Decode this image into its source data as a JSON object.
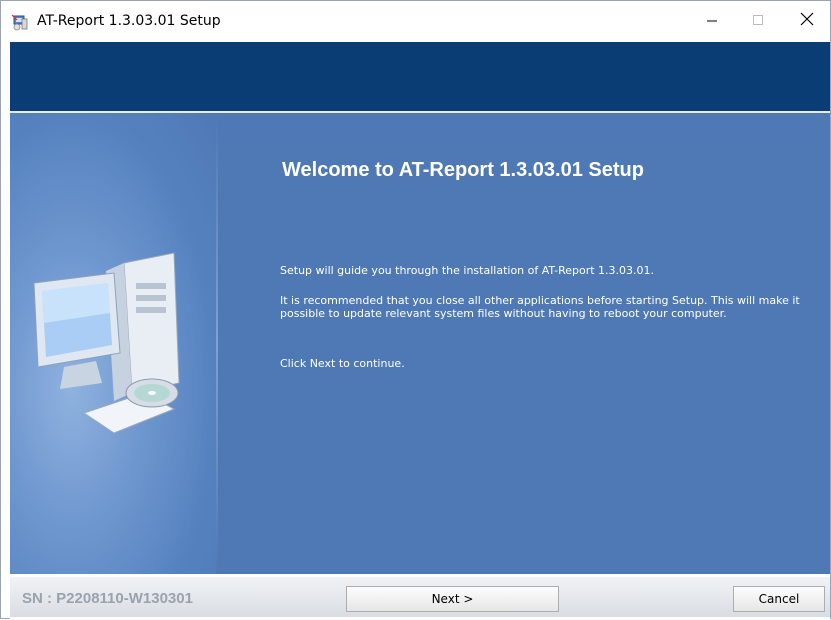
{
  "window": {
    "title": "AT-Report 1.3.03.01 Setup",
    "controls": [
      "minimize",
      "maximize",
      "close"
    ]
  },
  "content": {
    "heading": "Welcome to AT-Report 1.3.03.01 Setup",
    "paragraph1": "Setup will guide you through the installation of AT-Report 1.3.03.01.",
    "paragraph2": "It is recommended that you close all other applications before starting Setup. This will make it possible to update relevant system files without having to reboot your computer.",
    "paragraph3": "Click Next to continue."
  },
  "footer": {
    "serial": "SN : P2208110-W130301",
    "next_label": "Next >",
    "cancel_label": "Cancel"
  },
  "icons": [
    "setup-app-icon",
    "minimize-icon",
    "maximize-icon",
    "close-icon",
    "computer-illustration"
  ],
  "colors": {
    "banner": "#0a3d74",
    "content_bg": "#4f79b5",
    "text": "#ffffff",
    "serial_text": "#9aa3ad"
  }
}
